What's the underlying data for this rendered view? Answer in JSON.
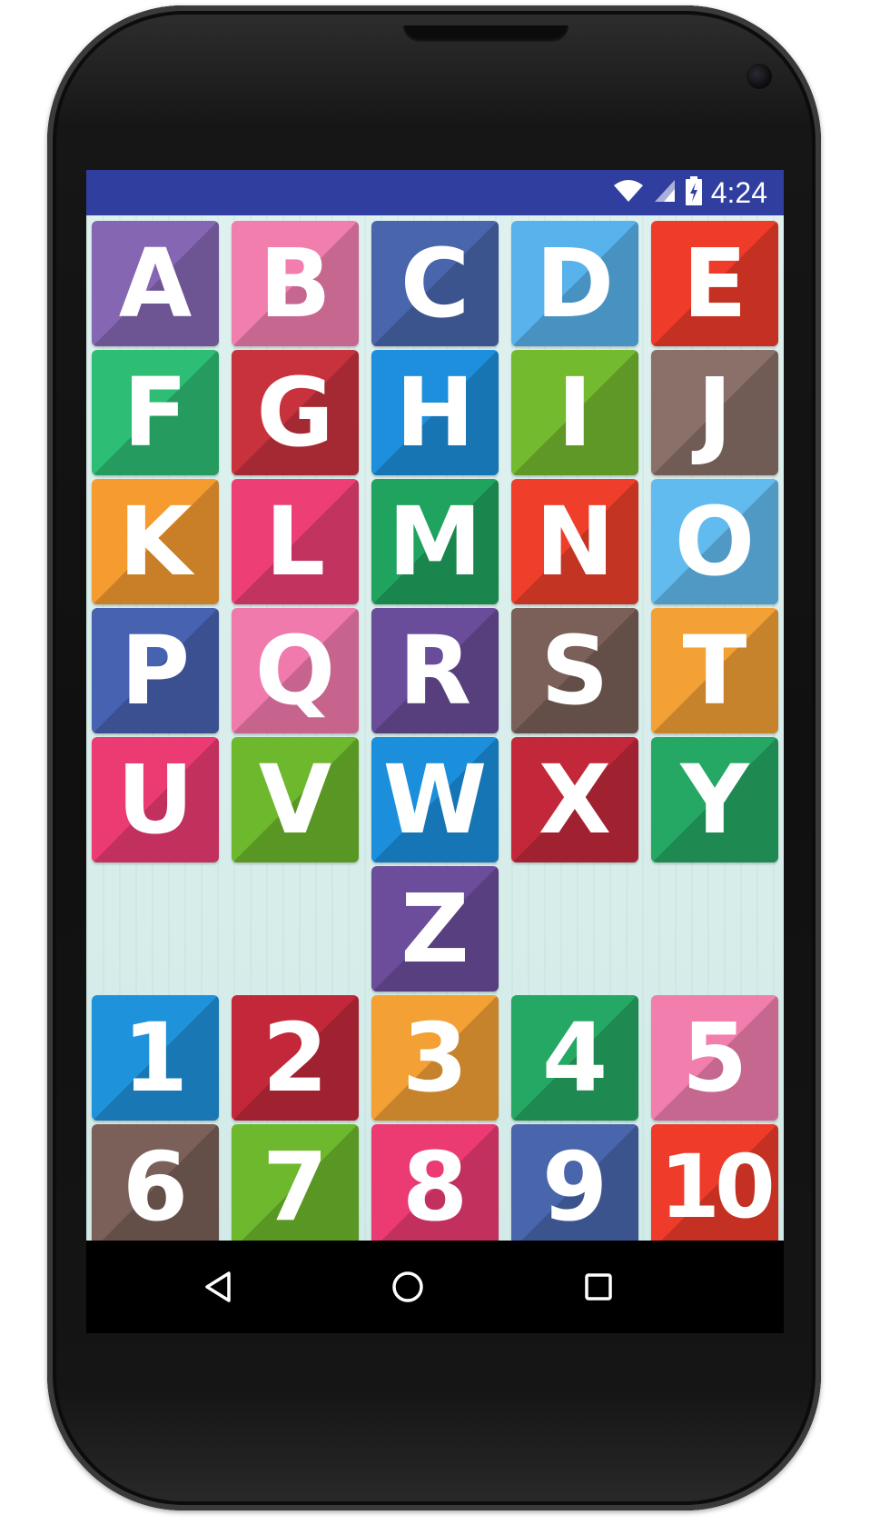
{
  "status_bar": {
    "time": "4:24",
    "icons": [
      "wifi-icon",
      "signal-icon",
      "battery-charging-icon"
    ],
    "color": "#303f9f"
  },
  "tiles_letters": [
    {
      "label": "A",
      "color": "#8566b3"
    },
    {
      "label": "B",
      "color": "#f27eae"
    },
    {
      "label": "C",
      "color": "#4966ad"
    },
    {
      "label": "D",
      "color": "#58b2ec"
    },
    {
      "label": "E",
      "color": "#ef3b2a"
    },
    {
      "label": "F",
      "color": "#2ebd74"
    },
    {
      "label": "G",
      "color": "#c8323d"
    },
    {
      "label": "H",
      "color": "#1d8fdc"
    },
    {
      "label": "I",
      "color": "#74ba2f"
    },
    {
      "label": "J",
      "color": "#8a7068"
    },
    {
      "label": "K",
      "color": "#f59b2f"
    },
    {
      "label": "L",
      "color": "#ed3f75"
    },
    {
      "label": "M",
      "color": "#1fa35f"
    },
    {
      "label": "N",
      "color": "#ef3f2b"
    },
    {
      "label": "O",
      "color": "#62bbef"
    },
    {
      "label": "P",
      "color": "#4762b0"
    },
    {
      "label": "Q",
      "color": "#f17aad"
    },
    {
      "label": "R",
      "color": "#6a4d9a"
    },
    {
      "label": "S",
      "color": "#7a6058"
    },
    {
      "label": "T",
      "color": "#f3a034"
    },
    {
      "label": "U",
      "color": "#ec3a73"
    },
    {
      "label": "V",
      "color": "#6db82d"
    },
    {
      "label": "W",
      "color": "#1b8fdc"
    },
    {
      "label": "X",
      "color": "#c3283a"
    },
    {
      "label": "Y",
      "color": "#25a863"
    }
  ],
  "tile_z": {
    "label": "Z",
    "color": "#6b4d9c"
  },
  "tiles_numbers": [
    {
      "label": "1",
      "color": "#1e93dc"
    },
    {
      "label": "2",
      "color": "#c3283a"
    },
    {
      "label": "3",
      "color": "#f3a034"
    },
    {
      "label": "4",
      "color": "#25a863"
    },
    {
      "label": "5",
      "color": "#f27eae"
    },
    {
      "label": "6",
      "color": "#7a6058"
    },
    {
      "label": "7",
      "color": "#6db82d"
    },
    {
      "label": "8",
      "color": "#ec3a73"
    },
    {
      "label": "9",
      "color": "#4966ad"
    },
    {
      "label": "10",
      "color": "#ef3b2a"
    }
  ],
  "navbar": {
    "buttons": [
      "back-icon",
      "home-icon",
      "recents-icon"
    ]
  }
}
